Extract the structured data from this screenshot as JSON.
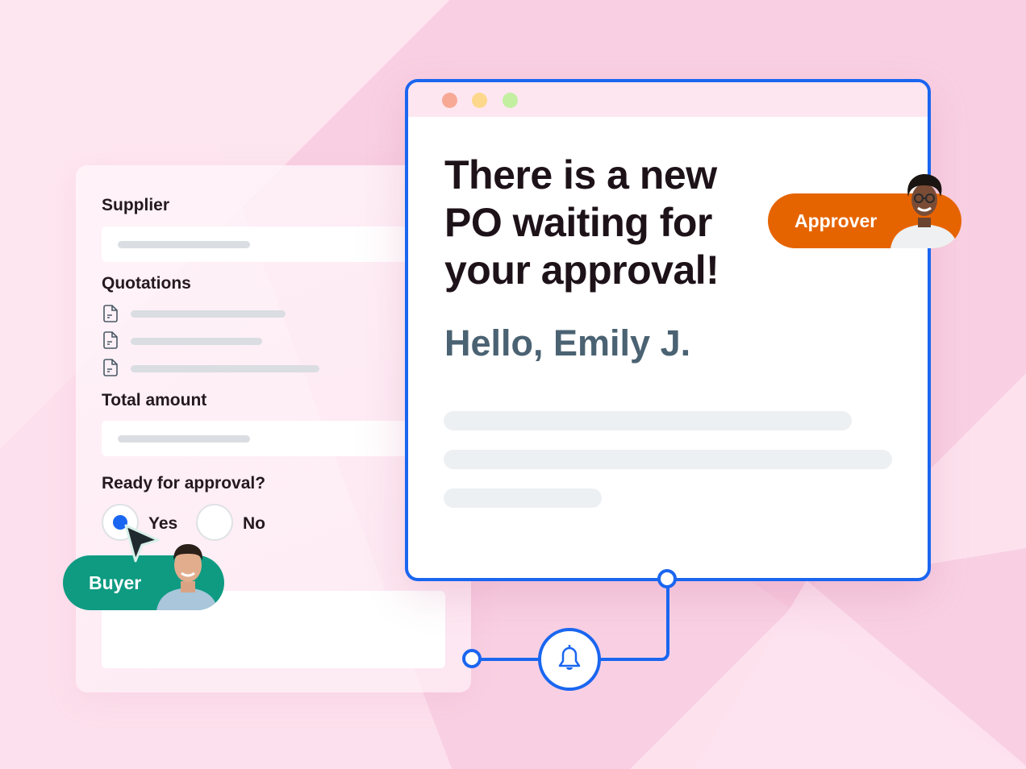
{
  "form": {
    "supplier_label": "Supplier",
    "quotations_label": "Quotations",
    "quotation_items": [
      {
        "icon": "document-icon"
      },
      {
        "icon": "document-icon"
      },
      {
        "icon": "document-icon"
      }
    ],
    "total_amount_label": "Total amount",
    "approval_question": "Ready for approval?",
    "options": [
      {
        "label": "Yes",
        "selected": true
      },
      {
        "label": "No",
        "selected": false
      }
    ]
  },
  "email_window": {
    "traffic_lights": [
      "#f7a996",
      "#fdd88c",
      "#c2f0a0"
    ],
    "headline": "There is a new PO waiting for your approval!",
    "greeting": "Hello, Emily J."
  },
  "roles": {
    "approver": {
      "label": "Approver",
      "color": "#e66400"
    },
    "buyer": {
      "label": "Buyer",
      "color": "#0f9b82"
    }
  },
  "connector": {
    "icon": "bell-icon",
    "color": "#1a66f0"
  },
  "colors": {
    "accent": "#1a66f0",
    "background": "#f9d0e3"
  }
}
